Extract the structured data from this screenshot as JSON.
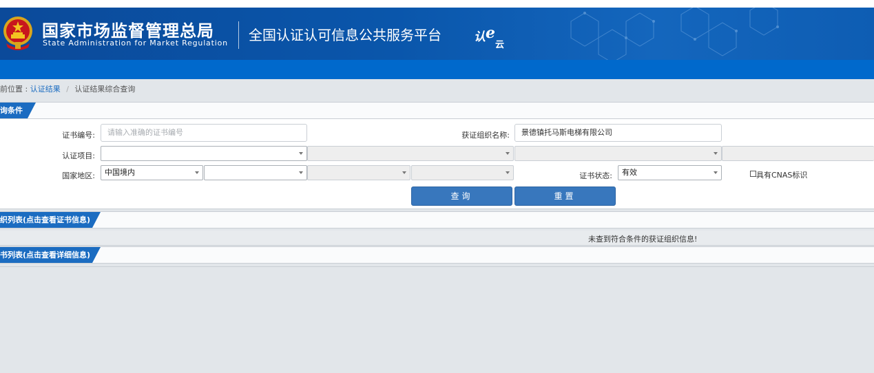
{
  "header": {
    "org_cn": "国家市场监督管理总局",
    "org_en": "State Administration  for  Market Regulation",
    "platform": "全国认证认可信息公共服务平台",
    "logo_text": "认e云",
    "colors": {
      "header_blue": "#0b4a9a",
      "bar_blue": "#0069cc",
      "tab_blue": "#1b6cc1",
      "button_blue": "#3877bd"
    }
  },
  "breadcrumb": {
    "prefix": "前位置 :",
    "link": "认证结果",
    "separator": "/",
    "current": "认证结果综合查询"
  },
  "query_panel": {
    "title": "询条件",
    "cert_no_label": "证书编号:",
    "cert_no_placeholder": "请输入准确的证书编号",
    "org_name_label": "获证组织名称:",
    "org_name_value": "景德镇托马斯电梯有限公司",
    "project_label": "认证项目:",
    "region_label": "国家地区:",
    "region_value": "中国境内",
    "status_label": "证书状态:",
    "status_value": "有效",
    "cnas_label": "具有CNAS标识",
    "search_button": "查询",
    "reset_button": "重置"
  },
  "org_list": {
    "title": "织列表(点击查看证书信息)",
    "empty_message": "未查到符合条件的获证组织信息!"
  },
  "cert_list": {
    "title": "书列表(点击查看详细信息)"
  }
}
